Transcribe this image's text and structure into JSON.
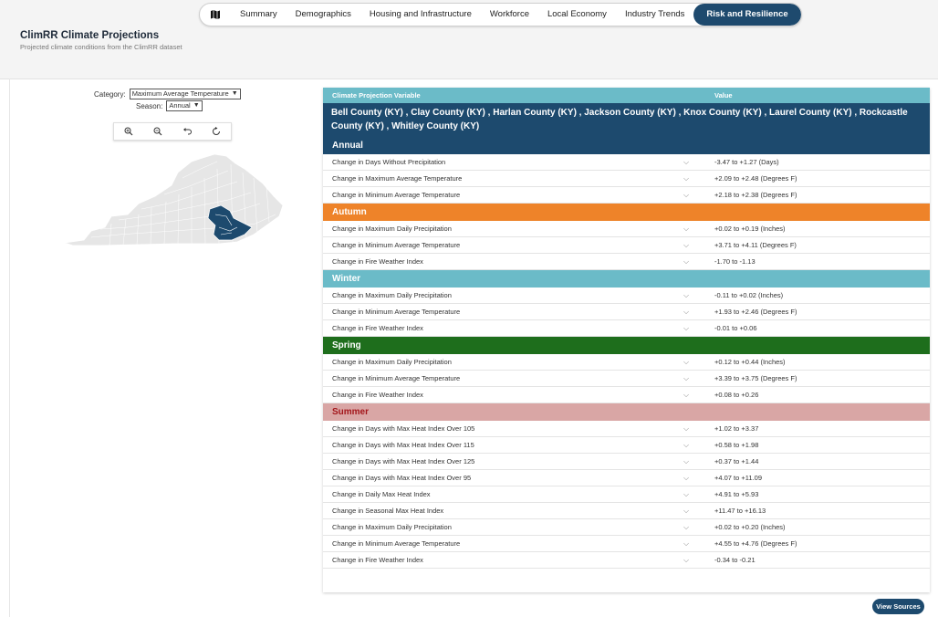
{
  "nav": {
    "icon": "map-icon",
    "tabs": [
      {
        "label": "Summary",
        "active": false
      },
      {
        "label": "Demographics",
        "active": false
      },
      {
        "label": "Housing and Infrastructure",
        "active": false
      },
      {
        "label": "Workforce",
        "active": false
      },
      {
        "label": "Local Economy",
        "active": false
      },
      {
        "label": "Industry Trends",
        "active": false
      },
      {
        "label": "Risk and Resilience",
        "active": true
      }
    ]
  },
  "header": {
    "title": "ClimRR Climate Projections",
    "subtitle": "Projected climate conditions from the ClimRR dataset"
  },
  "controls": {
    "category_label": "Category:",
    "category_value": "Maximum Average Temperature",
    "season_label": "Season:",
    "season_value": "Annual",
    "tools": [
      "zoom-in-icon",
      "zoom-out-icon",
      "undo-icon",
      "reset-icon"
    ]
  },
  "table": {
    "col_variable": "Climate Projection Variable",
    "col_value": "Value",
    "counties": "Bell County (KY) , Clay County (KY) , Harlan County (KY) , Jackson County (KY) , Knox County (KY) , Laurel County (KY) , Rockcastle County (KY) , Whitley County (KY)",
    "sections": [
      {
        "name": "Annual",
        "color": "#1d4a6e",
        "text_color": "#ffffff",
        "rows": [
          {
            "variable": "Change in Days Without Precipitation",
            "value": "-3.47 to +1.27 (Days)"
          },
          {
            "variable": "Change in Maximum Average Temperature",
            "value": "+2.09 to +2.48 (Degrees F)"
          },
          {
            "variable": "Change in Minimum Average Temperature",
            "value": "+2.18 to +2.38 (Degrees F)"
          }
        ]
      },
      {
        "name": "Autumn",
        "color": "#ee8329",
        "text_color": "#ffffff",
        "rows": [
          {
            "variable": "Change in Maximum Daily Precipitation",
            "value": "+0.02 to +0.19 (Inches)"
          },
          {
            "variable": "Change in Minimum Average Temperature",
            "value": "+3.71 to +4.11 (Degrees F)"
          },
          {
            "variable": "Change in Fire Weather Index",
            "value": "-1.70 to -1.13"
          }
        ]
      },
      {
        "name": "Winter",
        "color": "#6bbbc8",
        "text_color": "#ffffff",
        "rows": [
          {
            "variable": "Change in Maximum Daily Precipitation",
            "value": "-0.11 to +0.02 (Inches)"
          },
          {
            "variable": "Change in Minimum Average Temperature",
            "value": "+1.93 to +2.46 (Degrees F)"
          },
          {
            "variable": "Change in Fire Weather Index",
            "value": "-0.01 to +0.06"
          }
        ]
      },
      {
        "name": "Spring",
        "color": "#1e6e1c",
        "text_color": "#ffffff",
        "rows": [
          {
            "variable": "Change in Maximum Daily Precipitation",
            "value": "+0.12 to +0.44 (Inches)"
          },
          {
            "variable": "Change in Minimum Average Temperature",
            "value": "+3.39 to +3.75 (Degrees F)"
          },
          {
            "variable": "Change in Fire Weather Index",
            "value": "+0.08 to +0.26"
          }
        ]
      },
      {
        "name": "Summer",
        "color": "#d9a6a5",
        "text_color": "#a3161b",
        "rows": [
          {
            "variable": "Change in Days with Max Heat Index Over 105",
            "value": "+1.02 to +3.37"
          },
          {
            "variable": "Change in Days with Max Heat Index Over 115",
            "value": "+0.58 to +1.98"
          },
          {
            "variable": "Change in Days with Max Heat Index Over 125",
            "value": "+0.37 to +1.44"
          },
          {
            "variable": "Change in Days with Max Heat Index Over 95",
            "value": "+4.07 to +11.09"
          },
          {
            "variable": "Change in Daily Max Heat Index",
            "value": "+4.91 to +5.93"
          },
          {
            "variable": "Change in Seasonal Max Heat Index",
            "value": "+11.47 to +16.13"
          },
          {
            "variable": "Change in Maximum Daily Precipitation",
            "value": "+0.02 to +0.20 (Inches)"
          },
          {
            "variable": "Change in Minimum Average Temperature",
            "value": "+4.55 to +4.76 (Degrees F)"
          },
          {
            "variable": "Change in Fire Weather Index",
            "value": "-0.34 to -0.21"
          }
        ]
      }
    ]
  },
  "footer": {
    "view_sources": "View Sources"
  },
  "colors": {
    "accent": "#1d4a6e",
    "map_fill": "#e6e6e6",
    "map_selected": "#1d4a6e"
  }
}
